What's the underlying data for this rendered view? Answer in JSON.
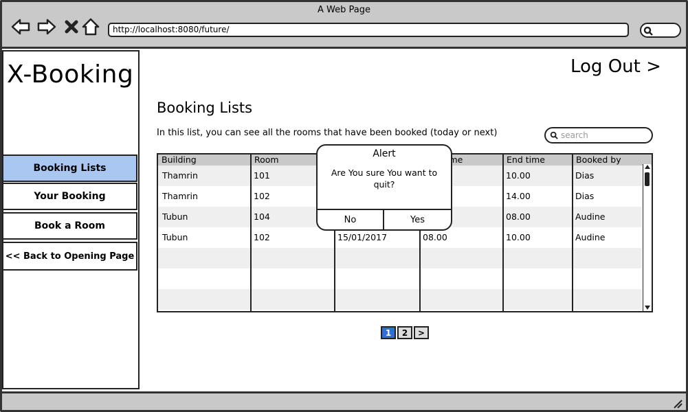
{
  "browser": {
    "window_title": "A Web Page",
    "url": "http://localhost:8080/future/"
  },
  "sidebar": {
    "logo": "X-Booking",
    "items": [
      {
        "label": "Booking Lists"
      },
      {
        "label": "Your Booking"
      },
      {
        "label": "Book a Room"
      },
      {
        "label": "<< Back to Opening Page"
      }
    ]
  },
  "header": {
    "logout_label": "Log Out >"
  },
  "main": {
    "title": "Booking Lists",
    "description": "In this list, you can see all the rooms that have been booked (today or next)",
    "search_placeholder": "search"
  },
  "table": {
    "columns": [
      "Building",
      "Room",
      "",
      "ime",
      "End time",
      "Booked by"
    ],
    "rows": [
      [
        "Thamrin",
        "101",
        "",
        "",
        "10.00",
        "Dias"
      ],
      [
        "Thamrin",
        "102",
        "",
        "",
        "14.00",
        "Dias"
      ],
      [
        "Tubun",
        "104",
        "",
        "",
        "08.00",
        "Audine"
      ],
      [
        "Tubun",
        "102",
        "15/01/2017",
        "08.00",
        "10.00",
        "Audine"
      ]
    ]
  },
  "alert": {
    "title": "Alert",
    "message": "Are You sure You want to quit?",
    "no_label": "No",
    "yes_label": "Yes"
  },
  "pagination": {
    "pages": [
      "1",
      "2"
    ],
    "current": "1",
    "next_label": ">"
  },
  "colors": {
    "active_nav": "#a9c7f0",
    "current_page": "#2f6fd6",
    "chrome_gray": "#c9c9c9",
    "row_alt": "#efefef"
  }
}
